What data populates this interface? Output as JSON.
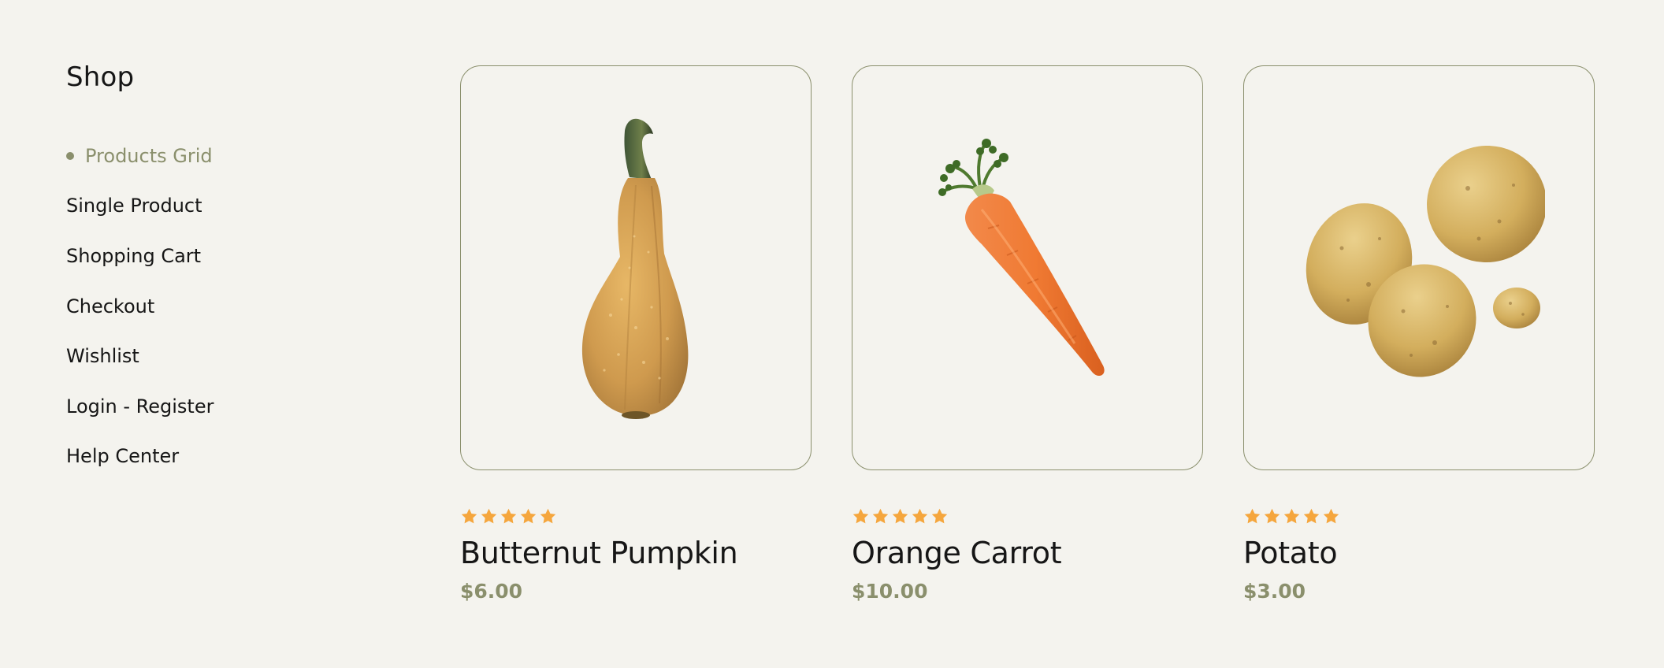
{
  "sidebar": {
    "title": "Shop",
    "items": [
      {
        "label": "Products Grid",
        "active": true
      },
      {
        "label": "Single Product",
        "active": false
      },
      {
        "label": "Shopping Cart",
        "active": false
      },
      {
        "label": "Checkout",
        "active": false
      },
      {
        "label": "Wishlist",
        "active": false
      },
      {
        "label": "Login - Register",
        "active": false
      },
      {
        "label": "Help Center",
        "active": false
      }
    ]
  },
  "colors": {
    "background": "#f4f3ee",
    "accent": "#8a8f6c",
    "star": "#f5a63d",
    "text": "#161616"
  },
  "products": [
    {
      "name": "Butternut Pumpkin",
      "price": "$6.00",
      "rating": 5,
      "image_icon": "butternut-pumpkin-image"
    },
    {
      "name": "Orange Carrot",
      "price": "$10.00",
      "rating": 5,
      "image_icon": "carrot-image"
    },
    {
      "name": "Potato",
      "price": "$3.00",
      "rating": 5,
      "image_icon": "potatoes-image"
    }
  ]
}
